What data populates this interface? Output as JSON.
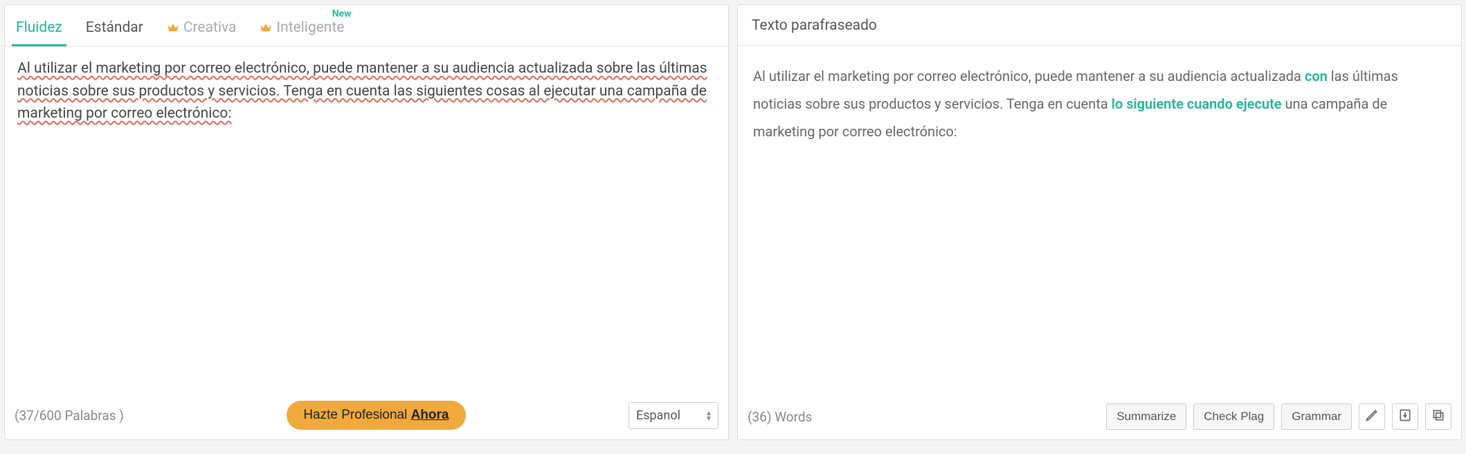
{
  "tabs": {
    "fluidez": "Fluidez",
    "estandar": "Estándar",
    "creativa": "Creativa",
    "inteligente": "Inteligente",
    "new_badge": "New"
  },
  "input": {
    "seg1": "Al utilizar el marketing por correo electrónico, puede mantener a su audiencia actualizada sobre las últimas noticias sobre sus productos y servicios. Tenga en cuenta las siguientes cosas al ejecutar una campaña de marketing por correo electrónico:"
  },
  "left_footer": {
    "wordcount": "(37/600 Palabras )",
    "pro_prefix": "Hazte Profesional ",
    "pro_bold": "Ahora",
    "lang": "Espanol"
  },
  "right_header": "Texto parafraseado",
  "output": {
    "p1": "Al utilizar el marketing por correo electrónico, puede mantener a su audiencia actualizada ",
    "h1": "con",
    "p2": " las últimas noticias sobre sus productos y servicios. Tenga en cuenta ",
    "h2": "lo siguiente cuando ejecute",
    "p3": " una campaña de marketing por correo electrónico:"
  },
  "right_footer": {
    "wordcount": "(36) Words",
    "summarize": "Summarize",
    "checkplag": "Check Plag",
    "grammar": "Grammar"
  }
}
